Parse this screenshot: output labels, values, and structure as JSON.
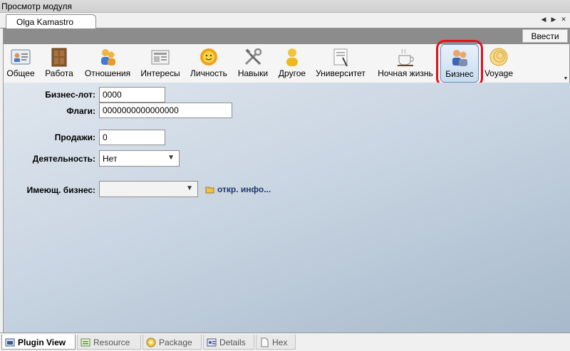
{
  "window": {
    "title": "Просмотр модуля"
  },
  "doc_tab": {
    "label": "Olga Kamastro"
  },
  "strip_controls": [
    "◀",
    "▶",
    "✕"
  ],
  "toolbar": {
    "apply_label": "Ввести"
  },
  "categories": [
    {
      "label": "Общее",
      "icon": "id-card-icon"
    },
    {
      "label": "Работа",
      "icon": "door-icon"
    },
    {
      "label": "Отношения",
      "icon": "people-icon"
    },
    {
      "label": "Интересы",
      "icon": "newspaper-icon"
    },
    {
      "label": "Личность",
      "icon": "sun-flower-icon"
    },
    {
      "label": "Навыки",
      "icon": "tools-icon"
    },
    {
      "label": "Другое",
      "icon": "person-icon"
    },
    {
      "label": "Университет",
      "icon": "diploma-icon"
    },
    {
      "label": "Ночная жизнь",
      "icon": "coffee-cup-icon"
    },
    {
      "label": "Бизнес",
      "icon": "business-people-icon",
      "selected": true
    },
    {
      "label": "Voyage",
      "icon": "shell-icon"
    }
  ],
  "form": {
    "business_lot": {
      "label": "Бизнес-лот:",
      "value": "0000"
    },
    "flags": {
      "label": "Флаги:",
      "value": "0000000000000000"
    },
    "sales": {
      "label": "Продажи:",
      "value": "0"
    },
    "activity": {
      "label": "Деятельность:",
      "value": "Нет"
    },
    "owned_business": {
      "label": "Имеющ. бизнес:",
      "value": ""
    },
    "info_link": "откр. инфо..."
  },
  "bottom_tabs": [
    {
      "label": "Plugin View",
      "active": true
    },
    {
      "label": "Resource"
    },
    {
      "label": "Package"
    },
    {
      "label": "Details"
    },
    {
      "label": "Hex"
    }
  ],
  "colors": {
    "highlight": "#e1121c",
    "content_bg": "#c9d5e2",
    "toolbar_bar": "#8c8c8c"
  }
}
